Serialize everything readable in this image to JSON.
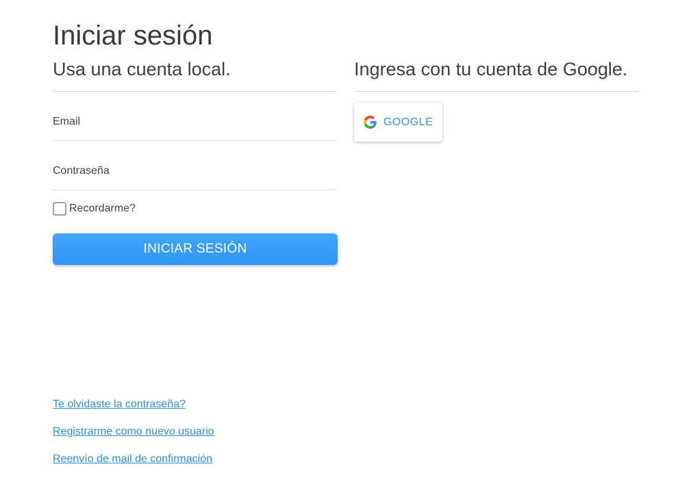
{
  "page": {
    "title": "Iniciar sesión"
  },
  "local": {
    "heading": "Usa una cuenta local.",
    "email_label": "Email",
    "email_value": "",
    "password_label": "Contraseña",
    "password_value": "",
    "remember_label": "Recordarme?",
    "remember_checked": false,
    "submit_label": "INICIAR SESIÓN"
  },
  "external": {
    "heading": "Ingresa con tu cuenta de Google.",
    "google_label": "GOOGLE",
    "google_icon": "google-g-icon"
  },
  "links": {
    "forgot": "Te olvidaste la contraseña?",
    "register": "Registrarme como nuevo usuario",
    "resend": "Reenvío de mail de confirmación"
  },
  "colors": {
    "primary": "#3399f5",
    "link": "#2f8fd8",
    "google_text": "#3b8ede"
  }
}
